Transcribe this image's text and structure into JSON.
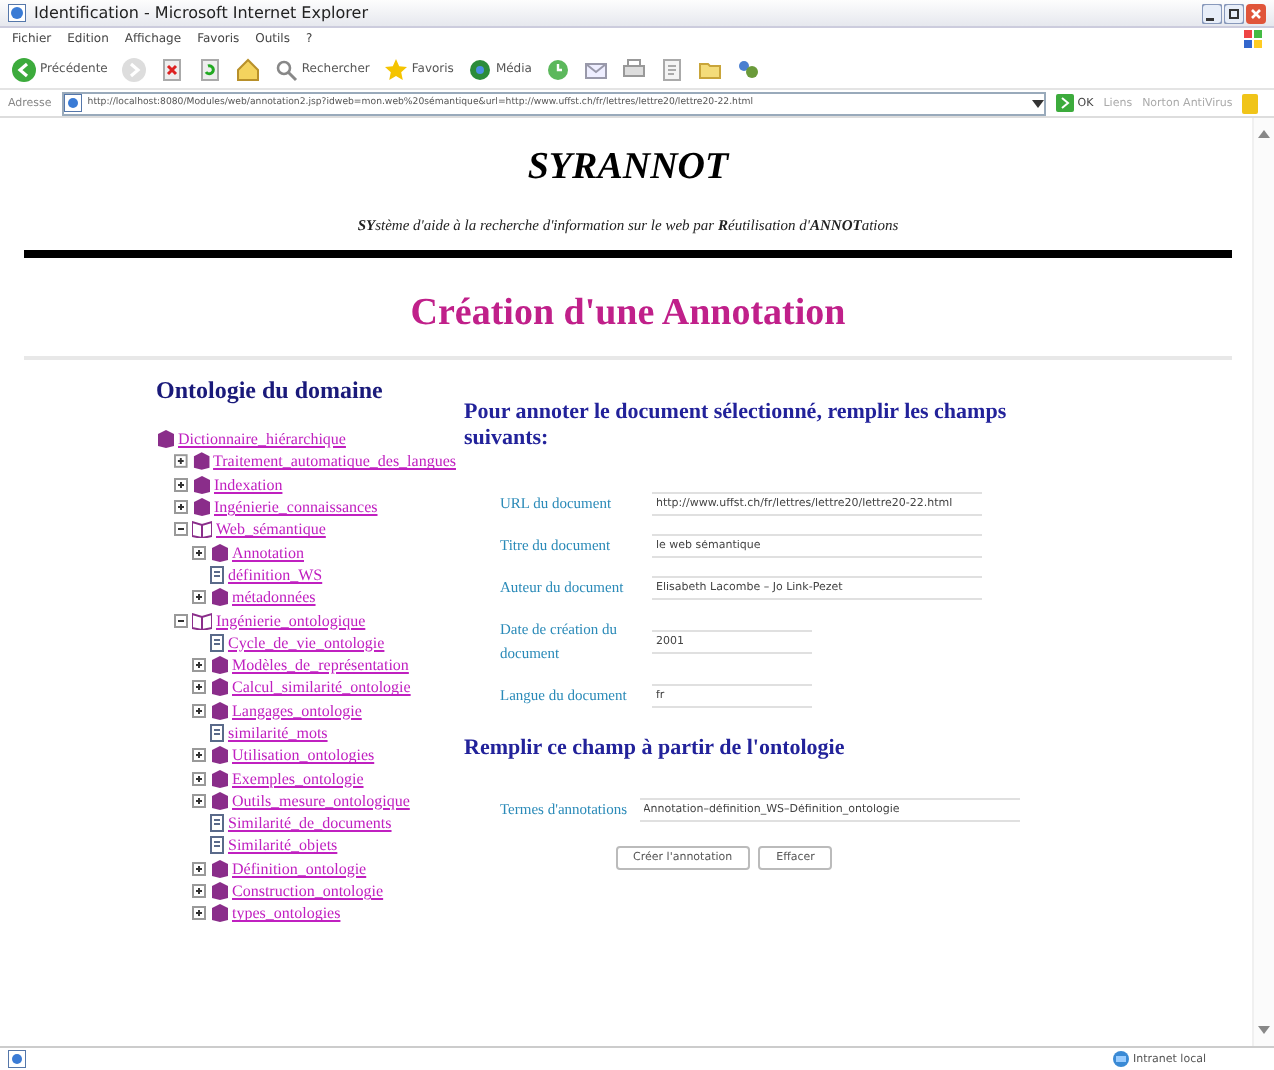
{
  "window": {
    "title": "Identification - Microsoft Internet Explorer"
  },
  "menu": [
    "Fichier",
    "Edition",
    "Affichage",
    "Favoris",
    "Outils",
    "?"
  ],
  "toolbar": [
    {
      "kind": "back",
      "label": "Précédente"
    },
    {
      "kind": "forward"
    },
    {
      "kind": "stop"
    },
    {
      "kind": "refresh"
    },
    {
      "kind": "home"
    },
    {
      "kind": "search",
      "label": "Rechercher"
    },
    {
      "kind": "favorites",
      "label": "Favoris"
    },
    {
      "kind": "media",
      "label": "Média"
    },
    {
      "kind": "history"
    },
    {
      "kind": "mail"
    },
    {
      "kind": "print"
    },
    {
      "kind": "edit"
    },
    {
      "kind": "folder"
    },
    {
      "kind": "messenger"
    }
  ],
  "address_bar": {
    "label": "Adresse",
    "value": "http://localhost:8080/Modules/web/annotation2.jsp?idweb=mon.web%20sémantique&url=http://www.uffst.ch/fr/lettres/lettre20/lettre20-22.html",
    "go": "OK",
    "links": "Liens",
    "norton": "Norton AntiVirus"
  },
  "page": {
    "title": "SYRANNOT",
    "subtitle": "**SY**stème d'aide à la recherche d'information sur le web par **R**éutilisation d'**ANNOT**ations",
    "heading": "Création d'une Annotation"
  },
  "ontology": {
    "title": "Ontologie du domaine",
    "tree": [
      {
        "label": "Dictionnaire_hiérarchique",
        "kind": "root",
        "children": [
          {
            "label": "Traitement_automatique_des_langues",
            "kind": "folder",
            "expanded": false
          },
          {
            "label": "Indexation",
            "kind": "folder",
            "expanded": false
          },
          {
            "label": "Ingénierie_connaissances",
            "kind": "folder",
            "expanded": false
          },
          {
            "label": "Web_sémantique",
            "kind": "folder",
            "expanded": true,
            "children": [
              {
                "label": "Annotation",
                "kind": "folder",
                "expanded": false
              },
              {
                "label": "définition_WS",
                "kind": "leaf"
              },
              {
                "label": "métadonnées",
                "kind": "folder",
                "expanded": false
              }
            ]
          },
          {
            "label": "Ingénierie_ontologique",
            "kind": "folder",
            "expanded": true,
            "children": [
              {
                "label": "Cycle_de_vie_ontologie",
                "kind": "leaf"
              },
              {
                "label": "Modèles_de_représentation",
                "kind": "folder",
                "expanded": false
              },
              {
                "label": "Calcul_similarité_ontologie",
                "kind": "folder",
                "expanded": false
              },
              {
                "label": "Langages_ontologie",
                "kind": "folder",
                "expanded": false
              },
              {
                "label": "similarité_mots",
                "kind": "leaf"
              },
              {
                "label": "Utilisation_ontologies",
                "kind": "folder",
                "expanded": false
              },
              {
                "label": "Exemples_ontologie",
                "kind": "folder",
                "expanded": false
              },
              {
                "label": "Outils_mesure_ontologique",
                "kind": "folder",
                "expanded": false
              },
              {
                "label": "Similarité_de_documents",
                "kind": "leaf"
              },
              {
                "label": "Similarité_objets",
                "kind": "leaf"
              },
              {
                "label": "Définition_ontologie",
                "kind": "folder",
                "expanded": false
              },
              {
                "label": "Construction_ontologie",
                "kind": "folder",
                "expanded": false
              },
              {
                "label": "types_ontologies",
                "kind": "folder",
                "expanded": false
              }
            ]
          }
        ]
      }
    ]
  },
  "form": {
    "heading": "Pour annoter le document sélectionné, remplir les champs suivants:",
    "fields": [
      {
        "label": "URL du document",
        "value": "http://www.uffst.ch/fr/lettres/lettre20/lettre20-22.html",
        "kind": "long"
      },
      {
        "label": "Titre du document",
        "value": "le web sémantique",
        "kind": "long"
      },
      {
        "label": "Auteur du document",
        "value": "Elisabeth Lacombe – Jo Link-Pezet",
        "kind": "long"
      },
      {
        "label": "Date de création du document",
        "value": "2001",
        "kind": "short"
      },
      {
        "label": "Langue du document",
        "value": "fr",
        "kind": "short"
      }
    ],
    "ontology_heading": "Remplir ce champ à partir de l'ontologie",
    "terms": {
      "label": "Termes d'annotations",
      "value": "Annotation–définition_WS–Définition_ontologie"
    },
    "buttons": [
      "Créer l'annotation",
      "Effacer"
    ]
  },
  "status_bar": {
    "zone": "Intranet local"
  }
}
